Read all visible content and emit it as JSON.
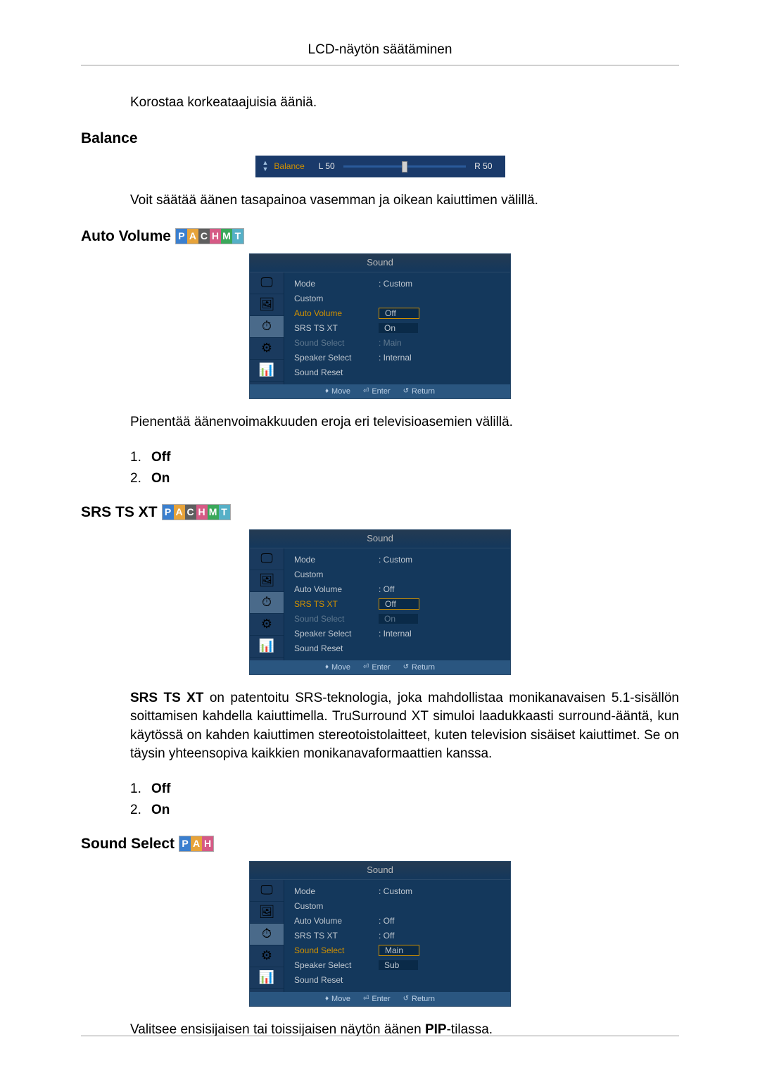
{
  "header": {
    "title": "LCD-näytön säätäminen"
  },
  "intro": {
    "line": "Korostaa korkeataajuisia ääniä."
  },
  "balance": {
    "heading": "Balance",
    "desc": "Voit säätää äänen tasapainoa vasemman ja oikean kaiuttimen välillä.",
    "osd": {
      "label": "Balance",
      "left": "L  50",
      "right": "R  50"
    }
  },
  "autovolume": {
    "heading": "Auto Volume",
    "badges": [
      "P",
      "A",
      "C",
      "H",
      "M",
      "T"
    ],
    "desc": "Pienentää äänenvoimakkuuden eroja eri televisioasemien välillä.",
    "options": [
      "Off",
      "On"
    ],
    "osd": {
      "title": "Sound",
      "rows": [
        {
          "k": "Mode",
          "v": ": Custom"
        },
        {
          "k": "Custom",
          "v": ""
        },
        {
          "k": "Auto Volume",
          "v": "",
          "hl": true,
          "opts": [
            "Off",
            "On"
          ],
          "sel": 0
        },
        {
          "k": "SRS TS XT",
          "v": ""
        },
        {
          "k": "Sound Select",
          "v": ": Main",
          "dim": true
        },
        {
          "k": "Speaker Select",
          "v": ": Internal"
        },
        {
          "k": "Sound Reset",
          "v": ""
        }
      ],
      "footer": {
        "move": "Move",
        "enter": "Enter",
        "return": "Return"
      }
    }
  },
  "srs": {
    "heading": "SRS TS XT",
    "badges": [
      "P",
      "A",
      "C",
      "H",
      "M",
      "T"
    ],
    "desc_prefix": "SRS TS XT",
    "desc": " on patentoitu SRS-teknologia, joka mahdollistaa monikanavaisen 5.1-sisällön soittamisen kahdella kaiuttimella. TruSurround XT simuloi laadukkaasti surround-ääntä, kun käytössä on kahden kaiuttimen stereotoistolaitteet, kuten television sisäiset kaiuttimet. Se on täysin yhteensopiva kaikkien monikanavaformaattien kanssa.",
    "options": [
      "Off",
      "On"
    ],
    "osd": {
      "title": "Sound",
      "rows": [
        {
          "k": "Mode",
          "v": ": Custom"
        },
        {
          "k": "Custom",
          "v": ""
        },
        {
          "k": "Auto Volume",
          "v": ": Off"
        },
        {
          "k": "SRS TS XT",
          "v": "",
          "hl": true,
          "opts": [
            "Off",
            "On"
          ],
          "sel": 0
        },
        {
          "k": "Sound Select",
          "v": "",
          "dim": true
        },
        {
          "k": "Speaker Select",
          "v": ": Internal"
        },
        {
          "k": "Sound Reset",
          "v": ""
        }
      ],
      "footer": {
        "move": "Move",
        "enter": "Enter",
        "return": "Return"
      }
    }
  },
  "soundselect": {
    "heading": "Sound Select",
    "badges": [
      "P",
      "A",
      "H"
    ],
    "desc_pre": "Valitsee ensisijaisen tai toissijaisen näytön äänen ",
    "desc_bold": "PIP",
    "desc_post": "-tilassa.",
    "osd": {
      "title": "Sound",
      "rows": [
        {
          "k": "Mode",
          "v": ":  Custom"
        },
        {
          "k": "Custom",
          "v": ""
        },
        {
          "k": "Auto Volume",
          "v": ":  Off"
        },
        {
          "k": "SRS TS XT",
          "v": ":  Off"
        },
        {
          "k": "Sound Select",
          "v": "",
          "hl": true,
          "opts": [
            "Main",
            "Sub"
          ],
          "sel": 0
        },
        {
          "k": "Speaker Select",
          "v": ""
        },
        {
          "k": "Sound Reset",
          "v": ""
        }
      ],
      "footer": {
        "move": "Move",
        "enter": "Enter",
        "return": "Return"
      }
    }
  },
  "icons": {
    "tab1": "🖵",
    "tab2": "🖼",
    "tab3": "⏱",
    "tab4": "⚙",
    "tab5": "📊"
  }
}
